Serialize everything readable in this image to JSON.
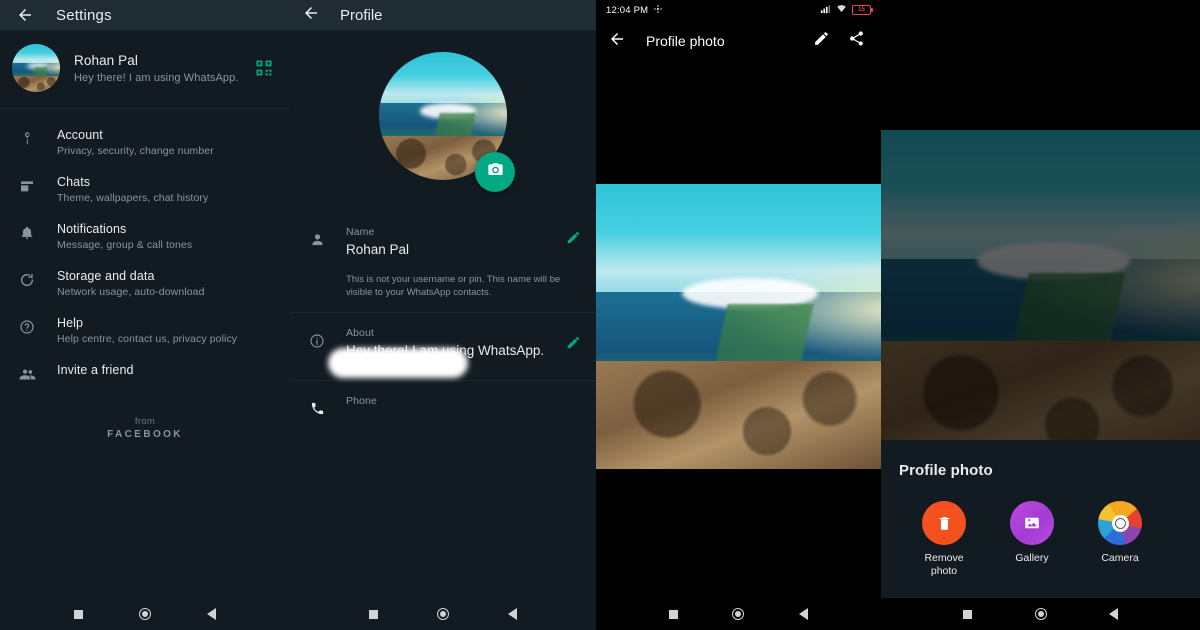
{
  "panel_settings": {
    "appbar": {
      "title": "Settings",
      "back_icon": "arrow-back-icon"
    },
    "profile": {
      "name": "Rohan Pal",
      "status": "Hey there! I am using WhatsApp.",
      "qr_icon": "qr-code-icon",
      "avatar_icon": "mountain-photo-avatar"
    },
    "items": [
      {
        "icon": "key-icon",
        "title": "Account",
        "subtitle": "Privacy, security, change number"
      },
      {
        "icon": "chat-icon",
        "title": "Chats",
        "subtitle": "Theme, wallpapers, chat history"
      },
      {
        "icon": "bell-icon",
        "title": "Notifications",
        "subtitle": "Message, group & call tones"
      },
      {
        "icon": "storage-icon",
        "title": "Storage and data",
        "subtitle": "Network usage, auto-download"
      },
      {
        "icon": "help-circle-icon",
        "title": "Help",
        "subtitle": "Help centre, contact us, privacy policy"
      },
      {
        "icon": "people-icon",
        "title": "Invite a friend",
        "subtitle": ""
      }
    ],
    "footer": {
      "from": "from",
      "brand": "FACEBOOK"
    }
  },
  "panel_profile": {
    "appbar": {
      "title": "Profile",
      "back_icon": "arrow-back-icon"
    },
    "avatar": {
      "icon": "mountain-photo-avatar",
      "camera_button_icon": "camera-icon"
    },
    "fields": [
      {
        "icon": "person-icon",
        "label": "Name",
        "value": "Rohan Pal",
        "hint": "This is not your username or pin. This name will be visible to your WhatsApp contacts.",
        "edit_icon": "pencil-icon"
      },
      {
        "icon": "info-icon",
        "label": "About",
        "value": "Hey there! I am using WhatsApp.",
        "hint": "",
        "edit_icon": "pencil-icon"
      },
      {
        "icon": "phone-icon",
        "label": "Phone",
        "value": "",
        "hint": "",
        "edit_icon": ""
      }
    ]
  },
  "panel_photo": {
    "statusbar": {
      "time": "12:04 PM",
      "cast_icon": "cast-icon",
      "signal_icon": "signal-bars-icon",
      "wifi_icon": "wifi-icon",
      "battery_icon": "battery-icon",
      "battery_level": "15"
    },
    "appbar": {
      "title": "Profile photo",
      "back_icon": "arrow-back-icon",
      "edit_icon": "pencil-icon",
      "share_icon": "share-icon"
    }
  },
  "panel_sheet": {
    "sheet": {
      "title": "Profile photo",
      "options": [
        {
          "icon": "trash-icon",
          "label": "Remove\nphoto",
          "label_line1": "Remove",
          "label_line2": "photo",
          "color": "#f4511e"
        },
        {
          "icon": "gallery-icon",
          "label": "Gallery",
          "label_line1": "Gallery",
          "label_line2": "",
          "color": "#a23bd4"
        },
        {
          "icon": "camera-icon",
          "label": "Camera",
          "label_line1": "Camera",
          "label_line2": "",
          "color": "#f5a623"
        }
      ]
    }
  },
  "navbar": {
    "recents_icon": "square-recents-icon",
    "home_icon": "circle-home-icon",
    "back_icon": "triangle-back-icon"
  },
  "colors": {
    "accent_green": "#00a884",
    "app_bar": "#1f2c34",
    "background": "#111b21",
    "text_primary": "#e9edef",
    "text_secondary": "#8696a0",
    "battery_red": "#e5484d"
  }
}
